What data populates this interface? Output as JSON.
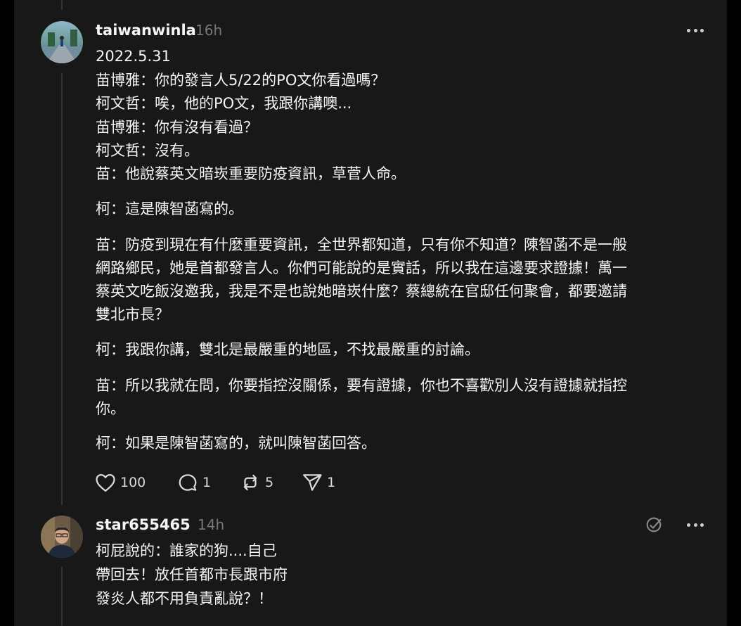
{
  "post1": {
    "username": "taiwanwinla",
    "time": "16h",
    "lines": [
      "2022.5.31",
      "苗博雅：你的發言人5/22的PO文你看過嗎？",
      "柯文哲：唉，他的PO文，我跟你講噢...",
      "苗博雅：你有沒有看過？",
      "柯文哲：沒有。",
      "苗：他說蔡英文暗崁重要防疫資訊，草菅人命。",
      "柯：這是陳智菡寫的。",
      "苗：防疫到現在有什麼重要資訊，全世界都知道，只有你不知道？陳智菡不是一般",
      "網路鄉民，她是首都發言人。你們可能說的是實話，所以我在這邊要求證據！萬一",
      "蔡英文吃飯沒邀我，我是不是也說她暗崁什麼？蔡總統在官邸任何聚會，都要邀請",
      "雙北市長？",
      "柯：我跟你講，雙北是最嚴重的地區，不找最嚴重的討論。",
      "苗：所以我就在問，你要指控沒關係，要有證據，你也不喜歡別人沒有證據就指控",
      "你。",
      "柯：如果是陳智菡寫的，就叫陳智菡回答。"
    ],
    "likes": "100",
    "comments": "1",
    "reposts": "5",
    "shares": "1"
  },
  "post2": {
    "username": "star655465",
    "time": "14h",
    "lines": [
      "柯屁說的：誰家的狗....自己",
      "帶回去！放任首都市長跟市府",
      "發炎人都不用負責亂說？！"
    ]
  },
  "colors": {
    "background": "#181818",
    "text": "#f3f5f7",
    "muted": "#777777",
    "thread_line": "#333638"
  }
}
